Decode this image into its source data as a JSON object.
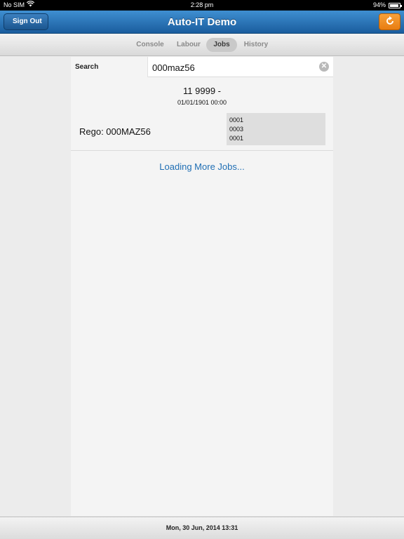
{
  "status_bar": {
    "carrier": "No SIM",
    "wifi_icon": "wifi-icon",
    "time": "2:28 pm",
    "battery": "94%"
  },
  "nav": {
    "title": "Auto-IT Demo",
    "back_label": "Sign Out",
    "refresh_icon": "refresh-icon"
  },
  "tabs": [
    {
      "label": "Console"
    },
    {
      "label": "Labour"
    },
    {
      "label": "Jobs",
      "selected": true
    },
    {
      "label": "History"
    }
  ],
  "search": {
    "label": "Search",
    "value": "000maz56",
    "clear_icon": "clear-icon"
  },
  "jobs": [
    {
      "number": "11 9999 -",
      "date": "01/01/1901 00:00",
      "rego": "Rego: 000MAZ56",
      "codes": [
        "0001",
        "0003",
        "0001"
      ]
    }
  ],
  "loading_text": "Loading More Jobs...",
  "footer": {
    "date": "Mon, 30 Jun, 2014 13:31"
  },
  "colors": {
    "nav_blue": "#1a5d9e",
    "refresh_orange": "#f28c1f",
    "link_blue": "#1f6eb4"
  }
}
